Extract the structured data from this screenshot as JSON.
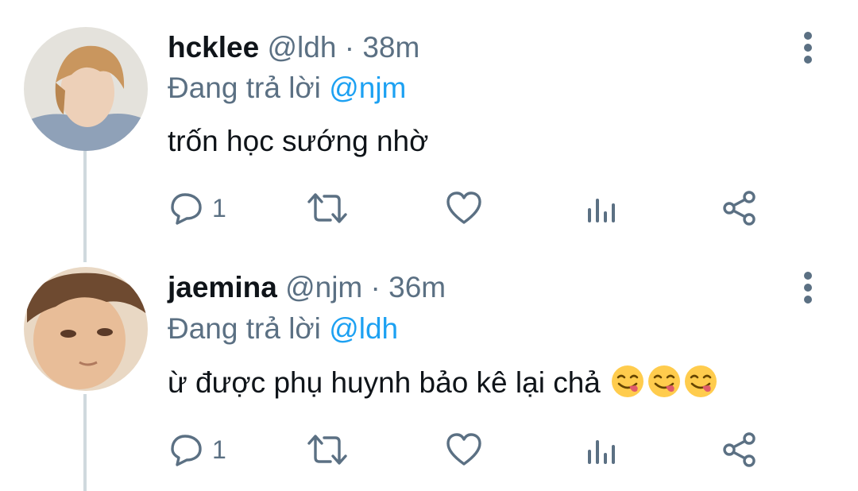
{
  "tweets": [
    {
      "display_name": "hcklee",
      "handle": "@ldh",
      "separator": "·",
      "time": "38m",
      "replying_prefix": "Đang trả lời",
      "replying_to": "@njm",
      "text": "trốn học sướng nhờ",
      "emojis": [],
      "reply_count": "1"
    },
    {
      "display_name": "jaemina",
      "handle": "@njm",
      "separator": "·",
      "time": "36m",
      "replying_prefix": "Đang trả lời",
      "replying_to": "@ldh",
      "text": "ừ được phụ huynh bảo kê lại chả",
      "emojis": [
        "face-savoring-food-emoji",
        "face-savoring-food-emoji",
        "face-savoring-food-emoji"
      ],
      "reply_count": "1"
    }
  ],
  "icons": {
    "more": "vertical-dots-icon",
    "reply": "speech-bubble-icon",
    "retweet": "retweet-icon",
    "like": "heart-icon",
    "analytics": "bar-chart-icon",
    "share": "share-icon"
  },
  "colors": {
    "text": "#0f1419",
    "secondary": "#5b7083",
    "mention": "#1da1f2",
    "thread_line": "#cfd9de"
  }
}
